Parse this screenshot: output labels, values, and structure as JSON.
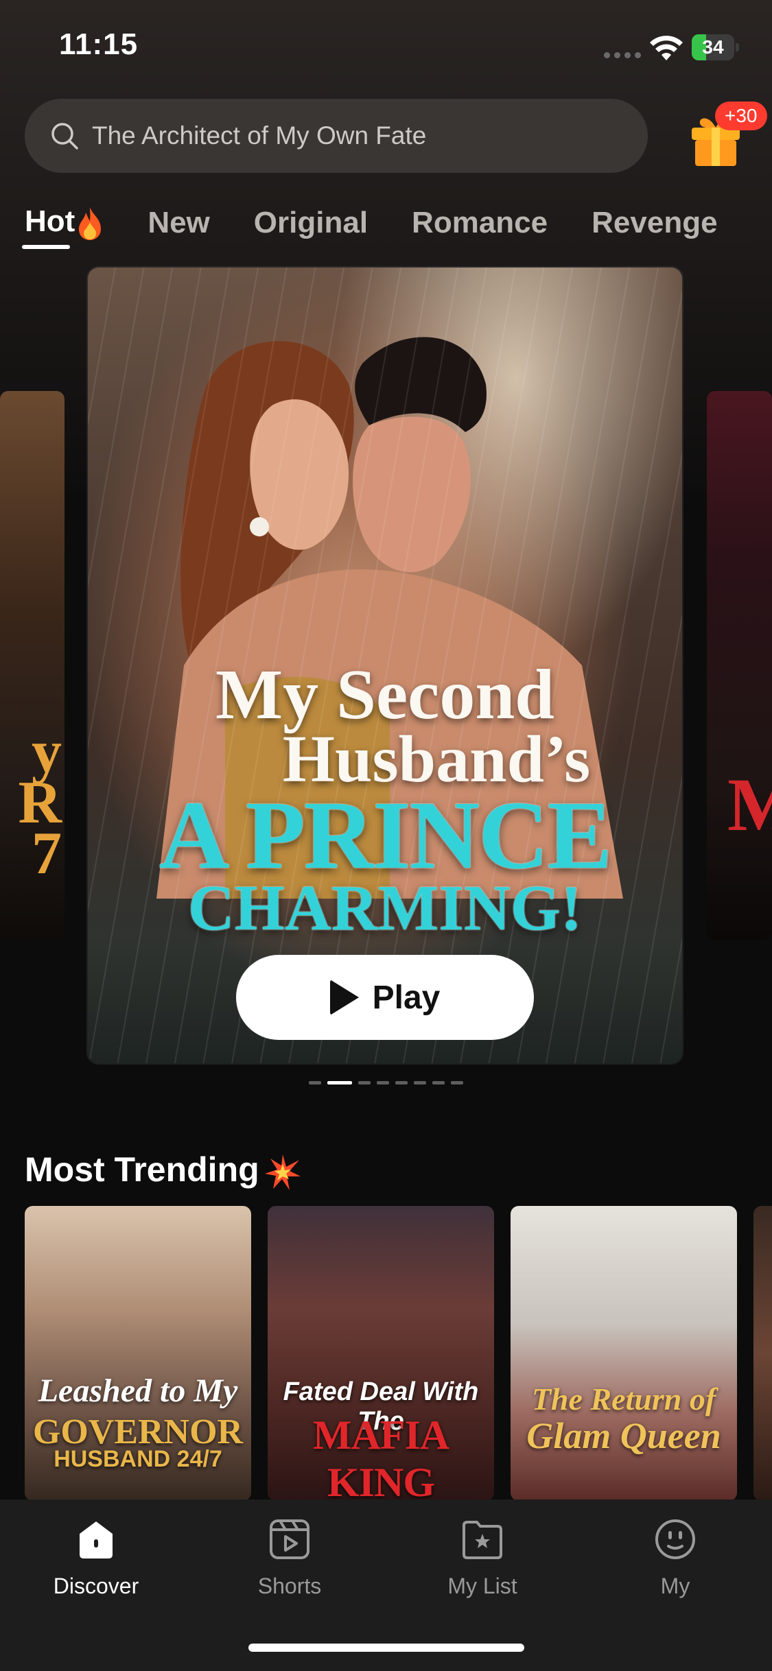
{
  "status_bar": {
    "time": "11:15",
    "battery": "34",
    "battery_level": 0.34
  },
  "search": {
    "placeholder": "The Architect of My Own Fate"
  },
  "gift": {
    "badge": "+30"
  },
  "tabs": [
    {
      "label": "Hot",
      "active": true
    },
    {
      "label": "New",
      "active": false
    },
    {
      "label": "Original",
      "active": false
    },
    {
      "label": "Romance",
      "active": false
    },
    {
      "label": "Revenge",
      "active": false
    }
  ],
  "featured": {
    "side_left_text": "y\nR\n7",
    "side_right_text": "M",
    "title_line1": "My Second",
    "title_line2": "Husband’s",
    "title_line3": "A PRINCE",
    "title_line4": "CHARMING!",
    "play_label": "Play",
    "pager_count": 8,
    "pager_active": 1
  },
  "trending": {
    "title": "Most Trending",
    "items": [
      {
        "line1": "Leashed to My",
        "line2": "GOVERNOR",
        "line3": "HUSBAND 24/7"
      },
      {
        "line1": "Fated Deal With The",
        "line2": "MAFIA KING"
      },
      {
        "line1": "The Return of",
        "line2": "Glam Queen"
      }
    ]
  },
  "nav": [
    {
      "label": "Discover",
      "icon": "home-icon",
      "active": true
    },
    {
      "label": "Shorts",
      "icon": "shorts-play-icon",
      "active": false
    },
    {
      "label": "My List",
      "icon": "star-folder-icon",
      "active": false
    },
    {
      "label": "My",
      "icon": "profile-face-icon",
      "active": false
    }
  ],
  "colors": {
    "accent_cyan": "#33d2d8",
    "badge_red": "#ff3b30",
    "battery_green": "#38c44b",
    "nav_bg": "#1d1d1d"
  }
}
